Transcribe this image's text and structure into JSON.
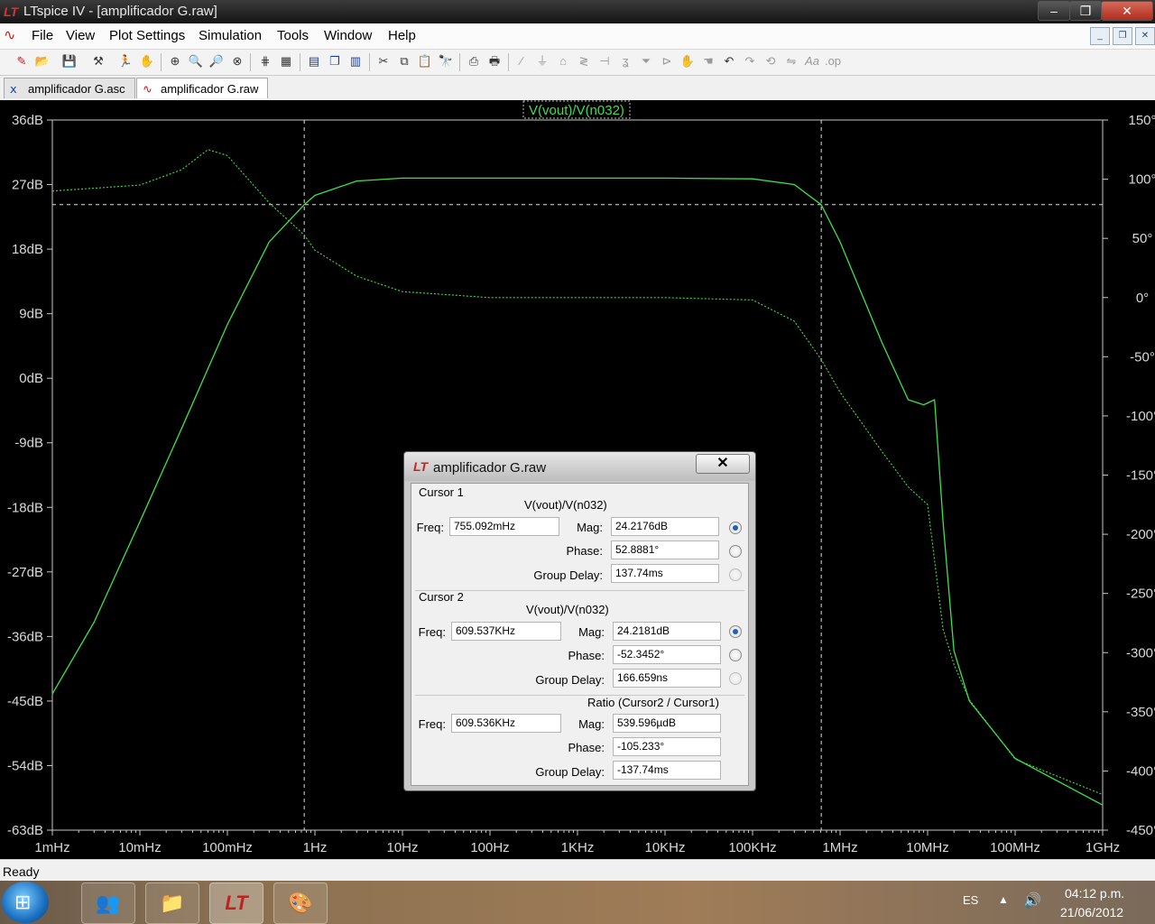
{
  "window": {
    "title": "LTspice IV - [amplificador G.raw]"
  },
  "menu": [
    "File",
    "View",
    "Plot Settings",
    "Simulation",
    "Tools",
    "Window",
    "Help"
  ],
  "tabs": [
    {
      "label": "amplificador G.asc",
      "icon": "schematic-icon"
    },
    {
      "label": "amplificador G.raw",
      "icon": "waveform-icon"
    }
  ],
  "chart_data": {
    "type": "line",
    "title": "V(vout)/V(n032)",
    "x_scale": "log",
    "x_ticks": [
      "1mHz",
      "10mHz",
      "100mHz",
      "1Hz",
      "10Hz",
      "100Hz",
      "1KHz",
      "10KHz",
      "100KHz",
      "1MHz",
      "10MHz",
      "100MHz",
      "1GHz"
    ],
    "y_left_ticks": [
      "36dB",
      "27dB",
      "18dB",
      "9dB",
      "0dB",
      "-9dB",
      "-18dB",
      "-27dB",
      "-36dB",
      "-45dB",
      "-54dB",
      "-63dB"
    ],
    "y_right_ticks": [
      "150°",
      "100°",
      "50°",
      "0°",
      "-50°",
      "-100°",
      "-150°",
      "-200°",
      "-250°",
      "-300°",
      "-350°",
      "-400°",
      "-450°"
    ],
    "ylim_left": [
      -63,
      36
    ],
    "ylim_right": [
      -450,
      150
    ],
    "color": "#3fe04a",
    "magnitude_db": {
      "x_hz": [
        0.001,
        0.003,
        0.01,
        0.03,
        0.1,
        0.3,
        0.755,
        1,
        3,
        10,
        100,
        1000,
        10000,
        100000,
        300000,
        609537,
        1000000,
        3000000,
        6000000,
        9000000,
        12000000,
        15000000,
        20000000,
        30000000,
        100000000,
        1000000000
      ],
      "y": [
        -44,
        -34,
        -20,
        -7,
        7.5,
        19,
        24.2,
        25.5,
        27.5,
        27.9,
        27.9,
        27.9,
        27.9,
        27.8,
        27,
        24.2,
        19,
        5,
        -3,
        -3.7,
        -3,
        -20,
        -38,
        -45,
        -53,
        -59.5
      ]
    },
    "phase_deg": {
      "x_hz": [
        0.001,
        0.01,
        0.03,
        0.06,
        0.1,
        0.3,
        0.755,
        1,
        3,
        10,
        100,
        1000,
        10000,
        100000,
        300000,
        609537,
        1000000,
        3000000,
        6000000,
        10000000,
        15000000,
        20000000,
        30000000,
        100000000,
        1000000000
      ],
      "y": [
        90,
        95,
        108,
        125,
        120,
        80,
        52.9,
        40,
        18,
        5,
        0,
        0,
        0,
        -2,
        -20,
        -52.3,
        -80,
        -130,
        -160,
        -175,
        -280,
        -310,
        -340,
        -390,
        -420
      ]
    },
    "cursors": {
      "cursor1_hz": 0.755092,
      "cursor2_hz": 609537,
      "level_db": 24.2
    }
  },
  "dialog": {
    "title": "amplificador G.raw",
    "cursor1": {
      "label": "Cursor 1",
      "trace": "V(vout)/V(n032)",
      "freq": "755.092mHz",
      "mag": "24.2176dB",
      "phase": "52.8881°",
      "group_delay": "137.74ms"
    },
    "cursor2": {
      "label": "Cursor 2",
      "trace": "V(vout)/V(n032)",
      "freq": "609.537KHz",
      "mag": "24.2181dB",
      "phase": "-52.3452°",
      "group_delay": "166.659ns"
    },
    "ratio": {
      "label": "Ratio (Cursor2 / Cursor1)",
      "freq": "609.536KHz",
      "mag": "539.596µdB",
      "phase": "-105.233°",
      "group_delay": "-137.74ms"
    },
    "labels": {
      "freq": "Freq:",
      "mag": "Mag:",
      "phase": "Phase:",
      "group_delay": "Group Delay:"
    }
  },
  "status": "Ready",
  "taskbar": {
    "lang": "ES",
    "time": "04:12 p.m.",
    "date": "21/06/2012"
  }
}
